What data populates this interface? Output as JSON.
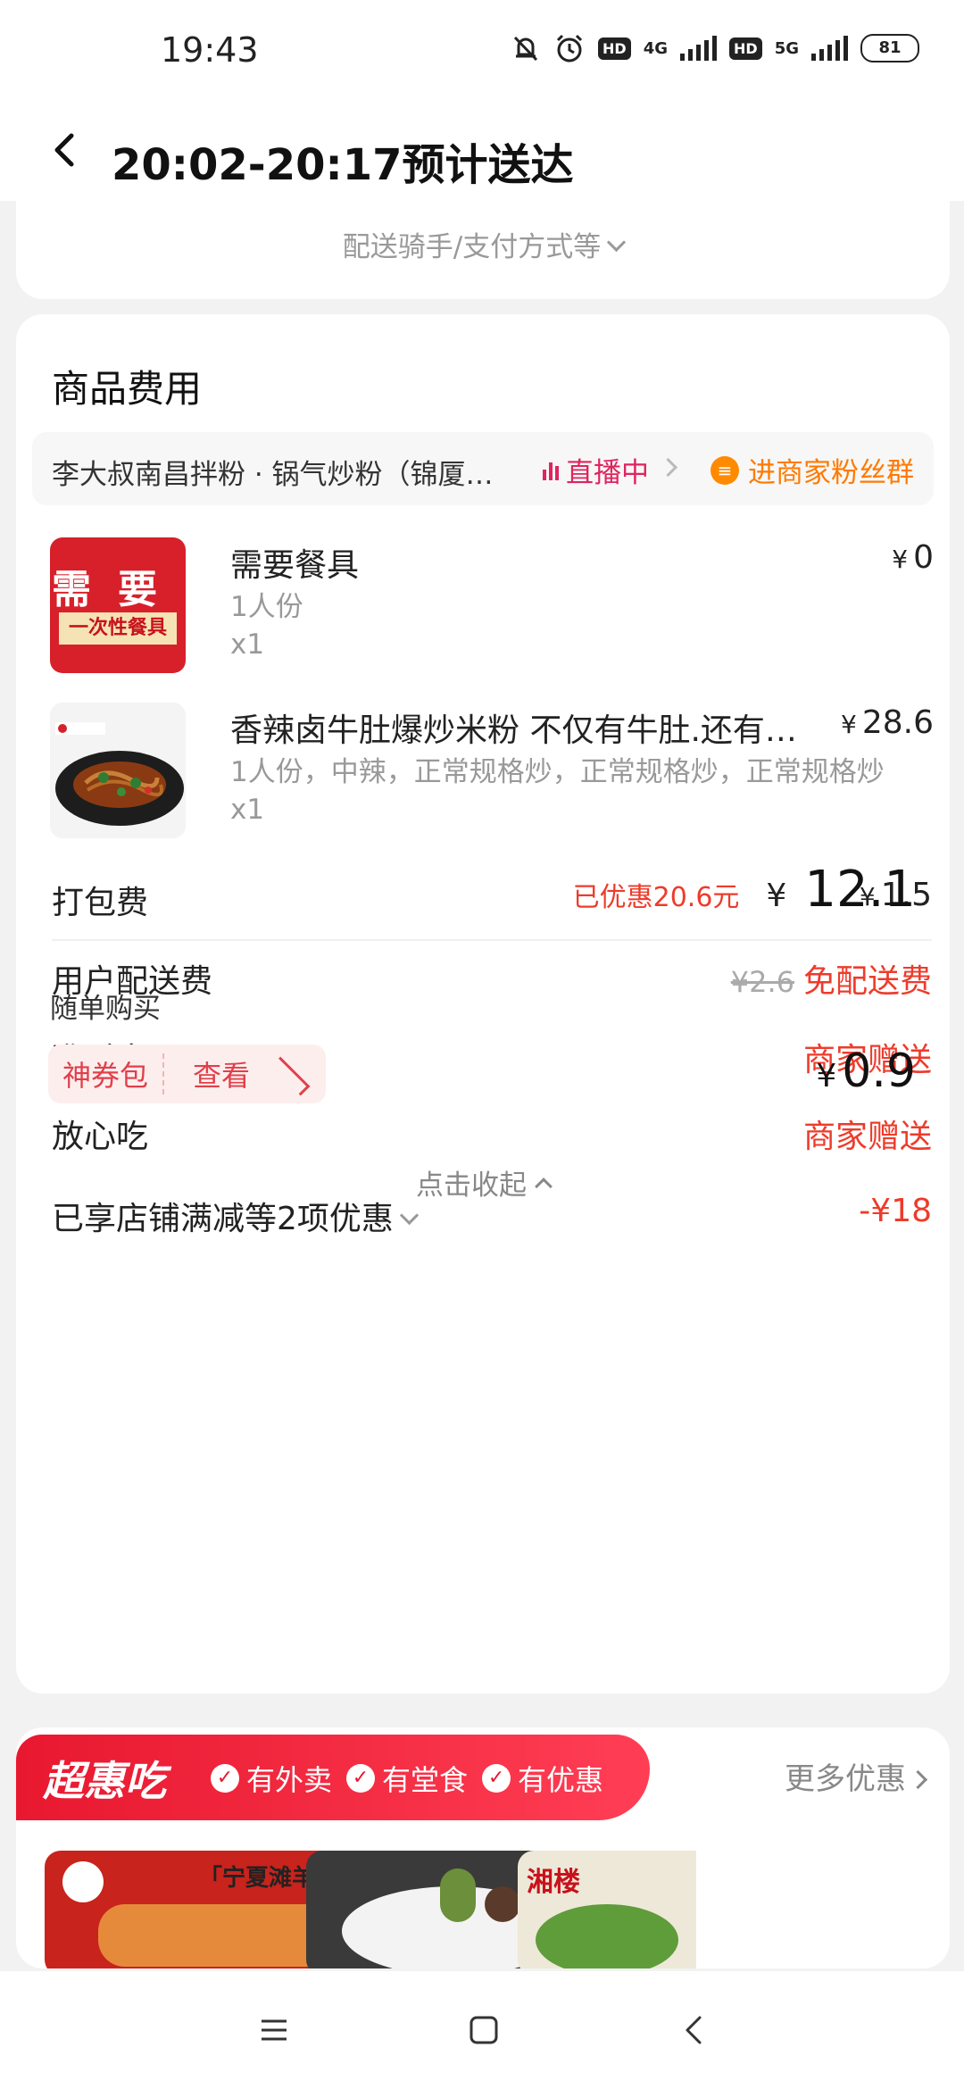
{
  "status": {
    "time": "19:43",
    "hd1": "HD",
    "net1": "4G",
    "hd2": "HD",
    "net2": "5G",
    "battery": "81"
  },
  "header": {
    "title": "20:02-20:17预计送达"
  },
  "delivery": {
    "options_label": "配送骑手/支付方式等"
  },
  "goods": {
    "section_title": "商品费用",
    "shop_name": "李大叔南昌拌粉 · 锅气炒粉（锦厦…",
    "live_label": "直播中",
    "fans_label": "进商家粉丝群",
    "items": [
      {
        "name": "需要餐具",
        "sub": "1人份",
        "qty": "x1",
        "currency": "¥",
        "price": "0",
        "thumb_text_top": "需要",
        "thumb_text_bottom": "一次性餐具"
      },
      {
        "name": "香辣卤牛肚爆炒米粉 不仅有牛肚.还有…",
        "sub": "1人份，中辣，正常规格炒，正常规格炒，正常规格炒",
        "qty": "x1",
        "currency": "¥",
        "price": "28.6"
      }
    ]
  },
  "fees": {
    "packing": {
      "label": "打包费",
      "currency": "¥",
      "value": "1.5"
    },
    "delivery": {
      "label": "用户配送费",
      "original": "¥2.6",
      "value": "免配送费"
    },
    "ontime": {
      "label": "准时宝",
      "value": "商家赠送"
    },
    "safe": {
      "label": "放心吃",
      "value": "商家赠送"
    },
    "discount": {
      "label": "已享店铺满减等2项优惠",
      "value": "-¥18"
    }
  },
  "summary": {
    "saved": "已优惠20.6元",
    "currency": "¥",
    "total": "12.1"
  },
  "addon": {
    "label": "随单购买",
    "coupon_name": "神券包",
    "coupon_action": "查看",
    "currency": "¥",
    "price": "0.9",
    "collapse": "点击收起"
  },
  "promo": {
    "brand": "超惠吃",
    "tags": [
      "有外卖",
      "有堂食",
      "有优惠"
    ],
    "more": "更多优惠",
    "images": [
      "「宁夏滩羊」全羊宴",
      "湘楼"
    ]
  },
  "colors": {
    "accent_red": "#ee3b2b",
    "live_pink": "#e0245e",
    "fans_orange": "#ff7a00"
  }
}
